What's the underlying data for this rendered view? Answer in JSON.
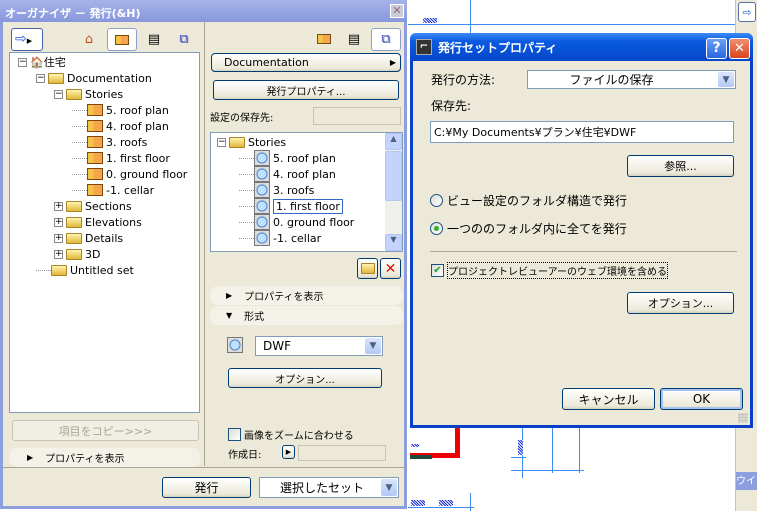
{
  "organizer": {
    "title": "オーガナイザ － 発行(&H)",
    "left_tree": [
      {
        "label": "住宅",
        "level": 0,
        "icon": "project-icon",
        "expander": "minus"
      },
      {
        "label": "Documentation",
        "level": 1,
        "icon": "folder-icon",
        "expander": "minus"
      },
      {
        "label": "Stories",
        "level": 2,
        "icon": "folder-icon",
        "expander": "minus"
      },
      {
        "label": "5. roof plan",
        "level": 3,
        "icon": "story-icon"
      },
      {
        "label": "4. roof plan",
        "level": 3,
        "icon": "story-icon"
      },
      {
        "label": "3. roofs",
        "level": 3,
        "icon": "story-icon"
      },
      {
        "label": "1. first floor",
        "level": 3,
        "icon": "story-icon"
      },
      {
        "label": "0. ground floor",
        "level": 3,
        "icon": "story-icon"
      },
      {
        "label": "-1. cellar",
        "level": 3,
        "icon": "story-icon"
      },
      {
        "label": "Sections",
        "level": 2,
        "icon": "folder-icon",
        "expander": "plus"
      },
      {
        "label": "Elevations",
        "level": 2,
        "icon": "folder-icon",
        "expander": "plus"
      },
      {
        "label": "Details",
        "level": 2,
        "icon": "folder-icon",
        "expander": "plus"
      },
      {
        "label": "3D",
        "level": 2,
        "icon": "folder-icon",
        "expander": "plus"
      },
      {
        "label": "Untitled set",
        "level": 1,
        "icon": "folder-icon"
      }
    ],
    "copy_button": "項目をコピー>>>",
    "left_show_properties": "プロパティを表示",
    "set_dropdown": "Documentation",
    "publish_properties_button": "発行プロパティ...",
    "save_location_label": "設定の保存先:",
    "save_location_value": "",
    "right_tree": [
      {
        "label": "Stories",
        "level": 0,
        "expander": "minus"
      },
      {
        "label": "5. roof plan",
        "level": 1
      },
      {
        "label": "4. roof plan",
        "level": 1
      },
      {
        "label": "3. roofs",
        "level": 1
      },
      {
        "label": "1. first floor",
        "level": 1,
        "selected": true
      },
      {
        "label": "0. ground floor",
        "level": 1
      },
      {
        "label": "-1. cellar",
        "level": 1
      }
    ],
    "right_show_properties": "プロパティを表示",
    "format_section": "形式",
    "format_value": "DWF",
    "options_button": "オプション...",
    "fit_zoom_label": "画像をズームに合わせる",
    "fit_zoom_checked": false,
    "created_label": "作成日:",
    "created_value": "",
    "publish_button": "発行",
    "scope_select": "選択したセット"
  },
  "dialog": {
    "title": "発行セットプロパティ",
    "method_label": "発行の方法:",
    "method_value": "ファイルの保存",
    "dest_label": "保存先:",
    "dest_value": "C:¥My Documents¥プラン¥住宅¥DWF",
    "browse_button": "参照...",
    "radio_folder_structure": "ビュー設定のフォルダ構造で発行",
    "radio_single_folder": "一つののフォルダ内に全てを発行",
    "selected_radio": "single_folder",
    "include_viewer_label": "プロジェクトレビューアーのウェブ環境を含める",
    "include_viewer_checked": true,
    "options_button": "オプション...",
    "cancel_button": "キャンセル",
    "ok_button": "OK"
  },
  "side_panel": {
    "title_fragment": "ウイ"
  },
  "colors": {
    "xp_title_active": "#0a4fd6",
    "palette_title_inactive": "#8d9ede",
    "dialog_bg": "#ece9d8",
    "selection_border": "#316ac5"
  }
}
